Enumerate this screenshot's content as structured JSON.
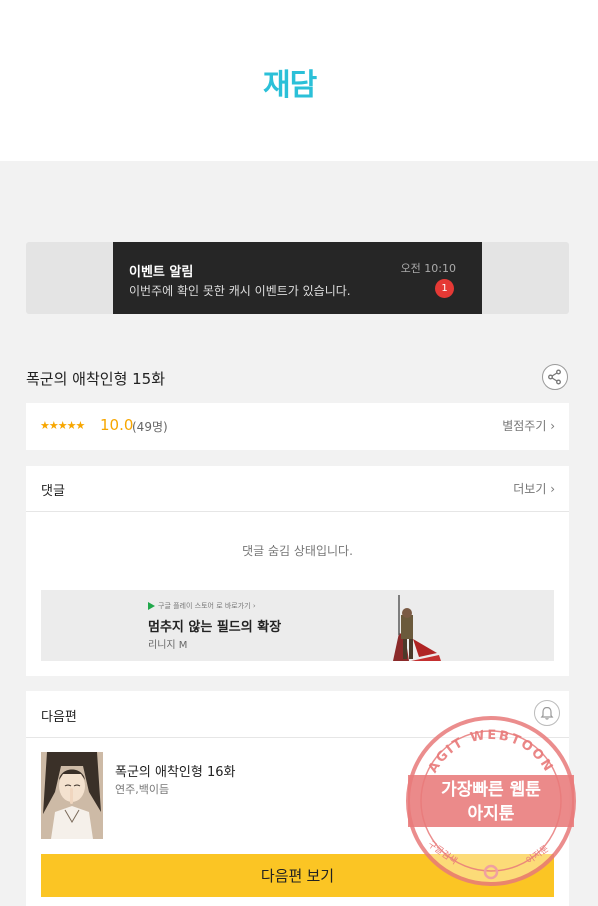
{
  "brand": {
    "logo_text": "재담",
    "color": "#2bc0d8"
  },
  "event": {
    "title": "이벤트 알림",
    "message": "이번주에 확인 못한 캐시 이벤트가 있습니다.",
    "time": "오전 10:10",
    "badge": "1"
  },
  "episode": {
    "title": "폭군의 애착인형 15화"
  },
  "rating": {
    "stars": "★★★★★",
    "score": "10.0",
    "count": "(49명)",
    "rate_link": "별점주기 ›"
  },
  "comments": {
    "heading": "댓글",
    "more_link": "더보기 ›",
    "hidden_message": "댓글 숨김 상태입니다.",
    "ad": {
      "sub": "구글 플레이 스토어 로 바로가기 ›",
      "title": "멈추지 않는 필드의 확장",
      "brand": "리니지 M"
    }
  },
  "next": {
    "heading": "다음편",
    "episode_title": "폭군의 애착인형 16화",
    "authors": "연주,백이듬",
    "button_label": "다음편 보기"
  },
  "watermark": {
    "ring_text": "AGIT WEBTOON",
    "line1": "가장빠른 웹툰",
    "line2": "아지툰",
    "bottom_left": "구글검색",
    "bottom_right": "아지툰"
  }
}
